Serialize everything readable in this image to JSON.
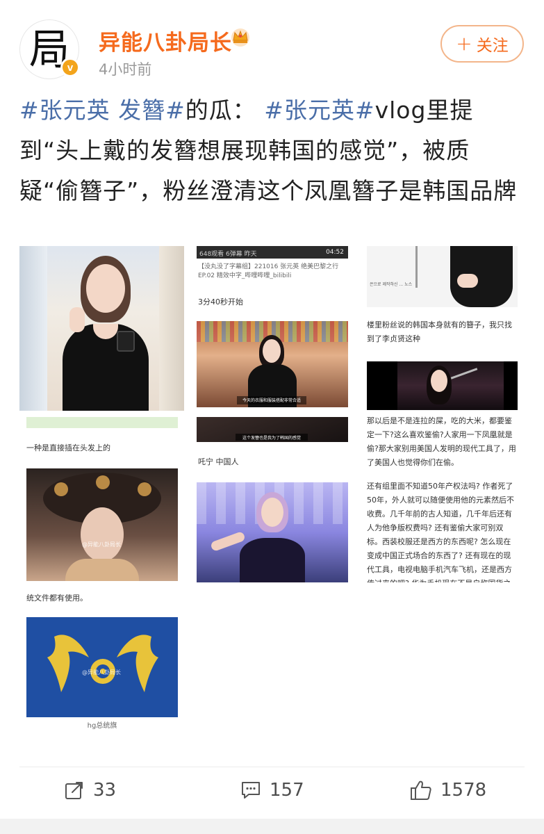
{
  "header": {
    "avatar_glyph": "局",
    "username": "异能八卦局长",
    "timestamp": "4小时前",
    "follow_label": "关注",
    "accent_color": "#f56a1d"
  },
  "post": {
    "segments": [
      {
        "type": "hashtag",
        "text": "#张元英 发簪#"
      },
      {
        "type": "text",
        "text": "的瓜："
      },
      {
        "type": "hashtag",
        "text": "#张元英#"
      },
      {
        "type": "text",
        "text": "vlog里提到“头上戴的发簪想展现韩国的感觉”，被质疑“偷簪子”，粉丝澄清这个凤凰簪子是韩国品牌"
      }
    ]
  },
  "images": {
    "t2": {
      "meta": "648观看  6弹幕  昨天",
      "duration": "04:52",
      "title": "【没丸没了字幕组】221016 张元英 绝美巴黎之行EP.02 精效中字_哔哩哔哩_bilibili",
      "start_note": "3分40秒开始",
      "subtitle_a": "今天的衣服和服装搭配非常合适",
      "subtitle_b": "这个发簪也是我为了韩国的感觉",
      "caption": "吒宁 中国人"
    },
    "t3": {
      "sign_text": "은으로 제작하신 ... 노스",
      "para1": "楼里粉丝说的韩国本身就有的簪子，我只找到了李贞贤这种",
      "para2": "那以后是不是连拉的屎，吃的大米，都要鉴定一下?这么喜欢鉴偷?人家用一下凤凰就是偷?那大家别用美国人发明的现代工具了，用了美国人也觉得你们在偷。",
      "para3": "还有组里面不知道50年产权法吗? 作者死了50年，外人就可以随便使用他的元素然后不收费。几千年前的古人知道，几千年后还有人为他争版权费吗? 还有鉴偷大家可别双标。西装校服还是西方的东西呢? 怎么现在变成中国正式场合的东西了? 还有现在的现代工具，电视电脑手机汽车飞机，还是西方传过来的吧? 华为手机现在不是自称国货之光?"
    },
    "t4": {
      "caption_top": "一种是直接插在头发上的",
      "watermark": "@异能八卦局长",
      "caption_bottom": "统文件都有使用。"
    },
    "t5": {
      "watermark": "@异能八卦局长",
      "caption": "hg总统旗"
    }
  },
  "footer": {
    "share_count": "33",
    "comment_count": "157",
    "like_count": "1578"
  }
}
